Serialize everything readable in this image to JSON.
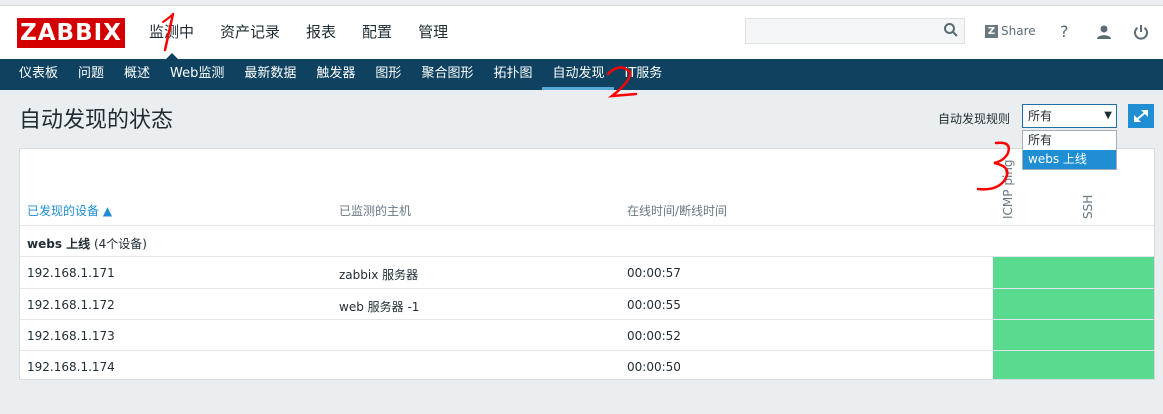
{
  "logo": "ZABBIX",
  "main_menu": [
    "监测中",
    "资产记录",
    "报表",
    "配置",
    "管理"
  ],
  "top_right": {
    "share": "Share",
    "help": "?"
  },
  "sub_menu": [
    "仪表板",
    "问题",
    "概述",
    "Web监测",
    "最新数据",
    "触发器",
    "图形",
    "聚合图形",
    "拓扑图",
    "自动发现",
    "IT服务"
  ],
  "page": {
    "title": "自动发现的状态",
    "filter_label": "自动发现规则",
    "filter_value": "所有",
    "filter_options": [
      "所有",
      "webs 上线"
    ]
  },
  "table": {
    "columns": {
      "device": "已发现的设备 ▲",
      "host": "已监测的主机",
      "uptime": "在线时间/断线时间",
      "icmp": "ICMP ping",
      "ssh": "SSH"
    },
    "group": {
      "name": "webs 上线",
      "count": "(4个设备)"
    },
    "rows": [
      {
        "ip": "192.168.1.171",
        "host": "zabbix 服务器",
        "time": "00:00:57"
      },
      {
        "ip": "192.168.1.172",
        "host": "web 服务器 -1",
        "time": "00:00:55"
      },
      {
        "ip": "192.168.1.173",
        "host": "",
        "time": "00:00:52"
      },
      {
        "ip": "192.168.1.174",
        "host": "",
        "time": "00:00:50"
      }
    ]
  },
  "colors": {
    "nav": "#0e4260",
    "status_up": "#59db8f",
    "accent": "#1f8ed3",
    "logo": "#d40000",
    "annotation": "#ff0000"
  },
  "annotations": [
    "1",
    "2",
    "3"
  ]
}
